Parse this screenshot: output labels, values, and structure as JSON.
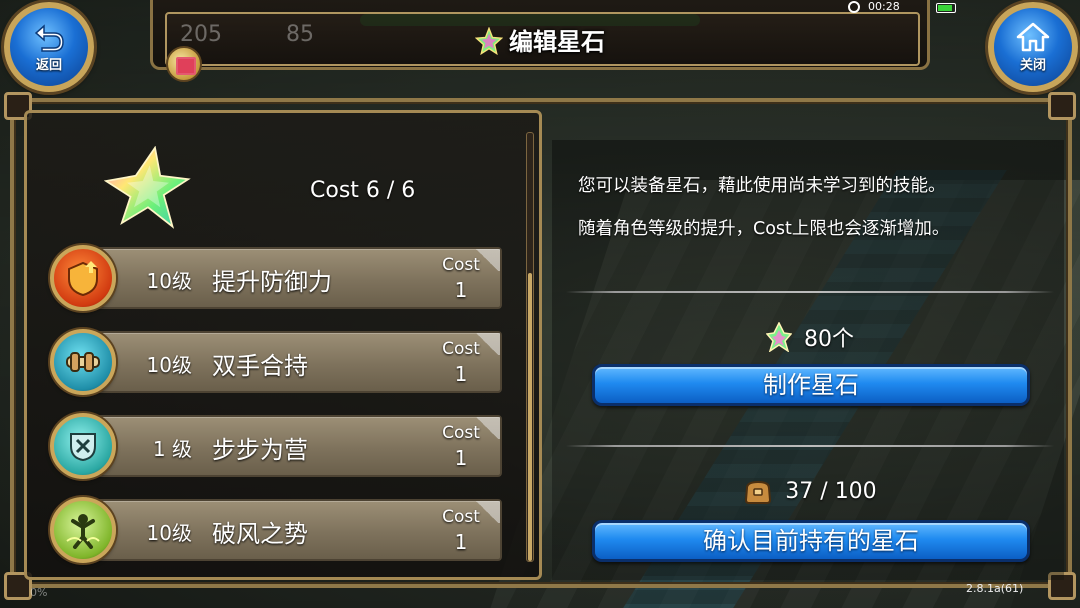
{
  "hud": {
    "title": "编辑星石",
    "stat_a": "205",
    "stat_b": "85",
    "time": "00:28",
    "back_label": "返回",
    "close_label": "关闭"
  },
  "left": {
    "cost_total": "Cost 6 / 6",
    "skills": [
      {
        "level": "10级",
        "name": "提升防御力",
        "cost_label": "Cost",
        "cost": "1",
        "icon": "shield-up-icon"
      },
      {
        "level": "10级",
        "name": "双手合持",
        "cost_label": "Cost",
        "cost": "1",
        "icon": "two-hand-grip-icon"
      },
      {
        "level": "1 级",
        "name": "步步为营",
        "cost_label": "Cost",
        "cost": "1",
        "icon": "steady-advance-icon"
      },
      {
        "level": "10级",
        "name": "破风之势",
        "cost_label": "Cost",
        "cost": "1",
        "icon": "wind-break-icon"
      }
    ]
  },
  "right": {
    "desc_line1": "您可以装备星石，藉此使用尚未学习到的技能。",
    "desc_line2": "随着角色等级的提升，Cost上限也会逐渐增加。",
    "stone_material_count": "80个",
    "craft_button": "制作星石",
    "owned_count": "37 / 100",
    "confirm_button": "确认目前持有的星石"
  },
  "footer": {
    "version": "2.8.1a(61)",
    "percent": "0%"
  },
  "colors": {
    "frame_gold": "#a58a54",
    "button_blue": "#1f8af0",
    "skill_bar": "#8a7e66"
  }
}
